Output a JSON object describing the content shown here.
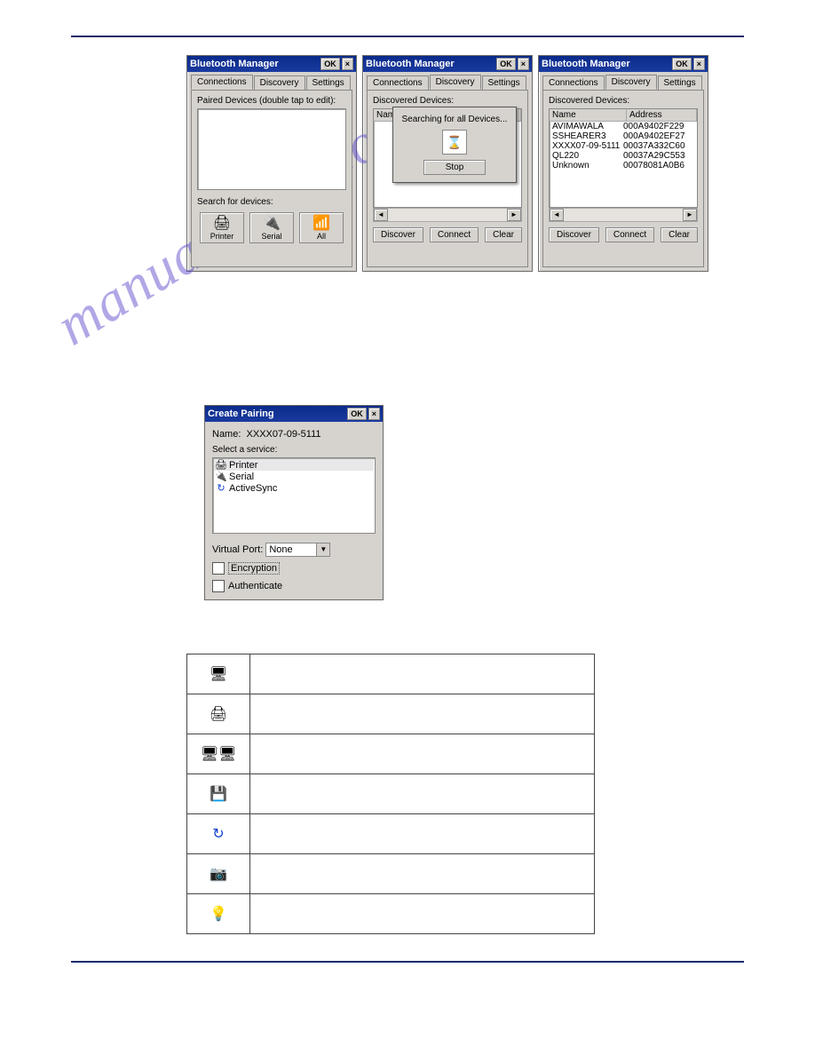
{
  "watermark": "manualshive.com",
  "bt_manager": {
    "title": "Bluetooth Manager",
    "ok": "OK",
    "close": "×",
    "tabs": {
      "connections": "Connections",
      "discovery": "Discovery",
      "settings": "Settings"
    },
    "win1": {
      "paired_label": "Paired Devices (double tap to edit):",
      "search_label": "Search for devices:",
      "printer": "Printer",
      "serial": "Serial",
      "all": "All"
    },
    "win2": {
      "discovered_label": "Discovered Devices:",
      "col_name": "Name",
      "searching": "Searching for all Devices...",
      "stop": "Stop",
      "discover": "Discover",
      "connect": "Connect",
      "clear": "Clear"
    },
    "win3": {
      "discovered_label": "Discovered Devices:",
      "col_name": "Name",
      "col_addr": "Address",
      "devices": [
        {
          "name": "AVIMAWALA",
          "addr": "000A9402F229"
        },
        {
          "name": "SSHEARER3",
          "addr": "000A9402EF27"
        },
        {
          "name": "XXXX07-09-5111",
          "addr": "00037A332C60"
        },
        {
          "name": "QL220",
          "addr": "00037A29C553"
        },
        {
          "name": "Unknown",
          "addr": "00078081A0B6"
        }
      ],
      "discover": "Discover",
      "connect": "Connect",
      "clear": "Clear"
    }
  },
  "pairing": {
    "title": "Create Pairing",
    "ok": "OK",
    "close": "×",
    "name_label": "Name:",
    "name_value": "XXXX07-09-5111",
    "select_label": "Select a service:",
    "services": {
      "printer": "Printer",
      "serial": "Serial",
      "activesync": "ActiveSync"
    },
    "virtual_port_label": "Virtual Port:",
    "virtual_port_value": "None",
    "encryption": "Encryption",
    "authenticate": "Authenticate"
  },
  "icon_table": {
    "rows": [
      {
        "icon": "lan-scanner-icon",
        "desc": ""
      },
      {
        "icon": "printer-icon",
        "desc": ""
      },
      {
        "icon": "dual-pcs-icon",
        "desc": ""
      },
      {
        "icon": "pc-card-icon",
        "desc": ""
      },
      {
        "icon": "activesync-globe-icon",
        "desc": ""
      },
      {
        "icon": "camera-icon",
        "desc": ""
      },
      {
        "icon": "device-icon",
        "desc": ""
      }
    ]
  }
}
